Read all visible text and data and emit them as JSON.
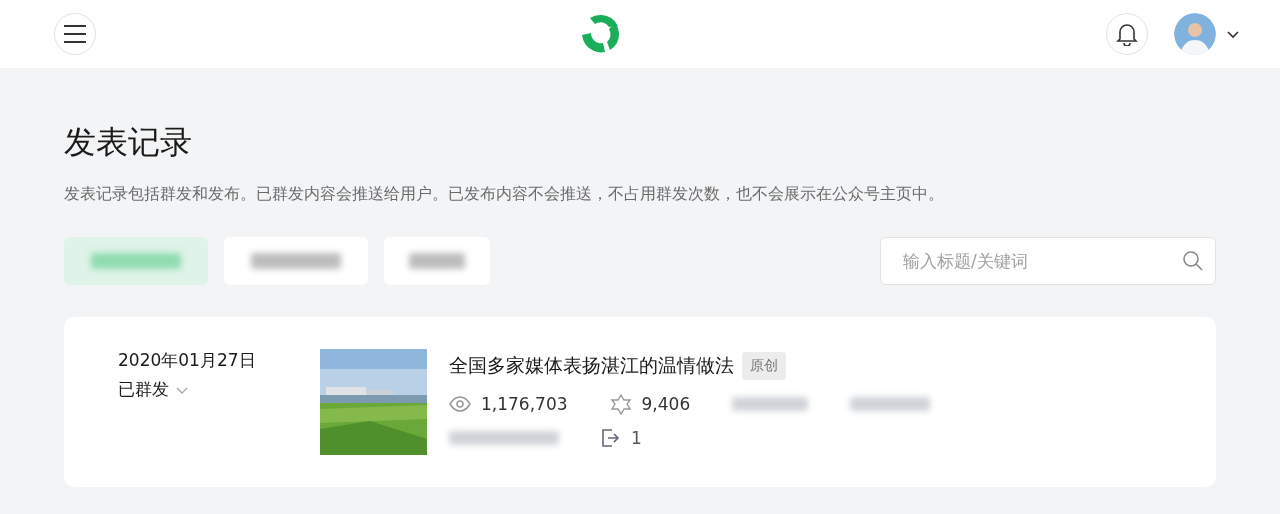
{
  "page": {
    "title": "发表记录",
    "description": "发表记录包括群发和发布。已群发内容会推送给用户。已发布内容不会推送，不占用群发次数，也不会展示在公众号主页中。"
  },
  "tabs": [
    {
      "selected": true
    },
    {
      "selected": false
    },
    {
      "selected": false
    }
  ],
  "search": {
    "placeholder": "输入标题/关键词"
  },
  "posts": [
    {
      "date": "2020年01月27日",
      "status": "已群发",
      "title": "全国多家媒体表扬湛江的温情做法",
      "badge": "原创",
      "views": "1,176,703",
      "likes": "9,406",
      "shares": "1"
    }
  ]
}
